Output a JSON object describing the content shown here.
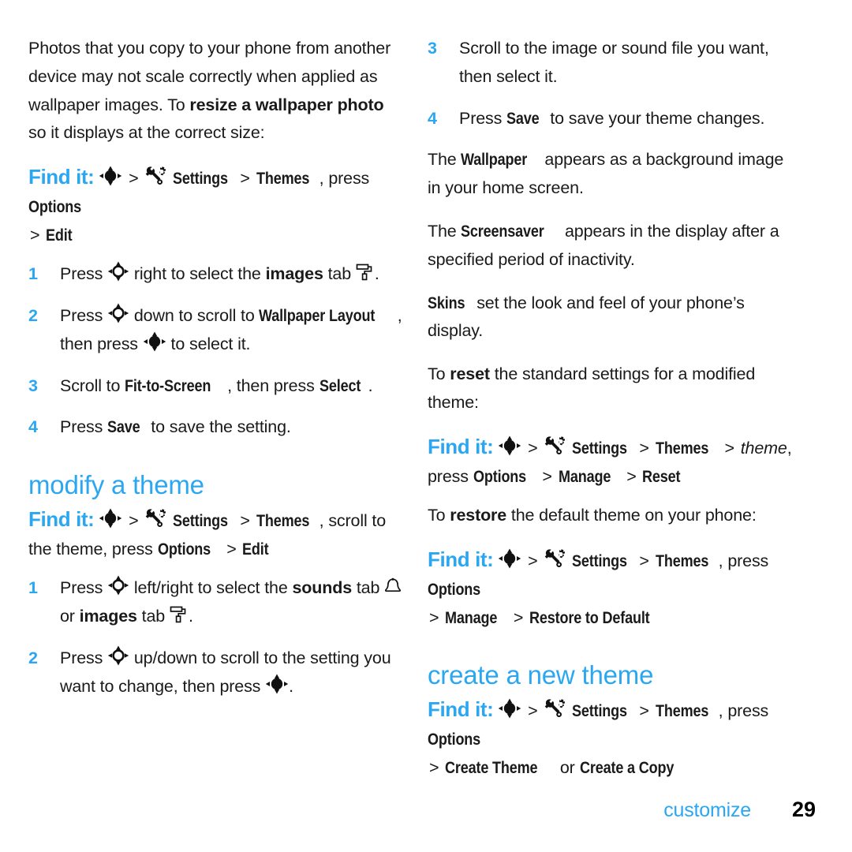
{
  "document": {
    "type": "phone-user-guide-page",
    "accent_color": "#2BA7F2",
    "text_color": "#1a1a1a",
    "background": "#ffffff"
  },
  "icons": {
    "nav_select": "navigation-key-select-icon",
    "nav_direction": "navigation-key-direction-icon",
    "settings": "settings-wrench-gear-icon",
    "images_tab": "paint-roller-icon",
    "sounds_tab": "bell-icon"
  },
  "left_column": {
    "intro_paragraph": {
      "part1": "Photos that you copy to your phone from another device may not scale correctly when applied as wallpaper images. To ",
      "bold1": "resize a wallpaper photo",
      "part2": " so it displays at the correct size:"
    },
    "find_it_resize": {
      "label": "Find it:",
      "sep": ">",
      "settings": "Settings",
      "themes": "Themes",
      "press_text": ", press ",
      "options": "Options",
      "sep2": ">",
      "edit": "Edit"
    },
    "steps_resize": [
      {
        "num": "1",
        "pre": "Press ",
        "mid": " right to select the ",
        "bold": "images",
        "post": " tab ",
        "end": "."
      },
      {
        "num": "2",
        "pre": "Press ",
        "mid": " down to scroll to ",
        "bold": "Wallpaper Layout",
        "post": ", then press ",
        "end": " to select it."
      },
      {
        "num": "3",
        "pre": "Scroll to ",
        "bold": "Fit-to-Screen",
        "mid": ", then press ",
        "bold2": "Select",
        "post": "."
      },
      {
        "num": "4",
        "pre": "Press ",
        "bold": "Save",
        "post": " to save the setting."
      }
    ],
    "heading_modify": "modify a theme",
    "find_it_modify": {
      "label": "Find it:",
      "sep": ">",
      "settings": "Settings",
      "themes": "Themes",
      "scroll_text": ", scroll to the theme, press ",
      "options": "Options",
      "sep2": ">",
      "edit": "Edit"
    },
    "steps_modify": [
      {
        "num": "1",
        "pre": "Press ",
        "mid": " left/right to select the ",
        "bold": "sounds",
        "post": " tab ",
        "mid2": " or ",
        "bold2": "images",
        "post2": " tab ",
        "end": "."
      },
      {
        "num": "2",
        "pre": "Press ",
        "mid": " up/down to scroll to the setting you want to change, then press ",
        "end": "."
      }
    ]
  },
  "right_column": {
    "steps_continued": [
      {
        "num": "3",
        "text": "Scroll to the image or sound file you want, then select it."
      },
      {
        "num": "4",
        "pre": "Press ",
        "bold": "Save",
        "post": " to save your theme changes."
      }
    ],
    "wallpaper_para": {
      "pre": "The ",
      "bold": "Wallpaper",
      "post": " appears as a background image in your home screen."
    },
    "screensaver_para": {
      "pre": "The ",
      "bold": "Screensaver",
      "post": " appears in the display after a specified period of inactivity."
    },
    "skins_para": {
      "bold": "Skins",
      "post": " set the look and feel of your phone’s display."
    },
    "reset_para": {
      "pre": "To ",
      "bold": "reset",
      "post": " the standard settings for a modified theme:"
    },
    "find_it_reset": {
      "label": "Find it:",
      "sep": ">",
      "settings": "Settings",
      "themes": "Themes",
      "sep_theme": ">",
      "theme_italic": "theme",
      "press_text": "press ",
      "options": "Options",
      "sep2": ">",
      "manage": "Manage",
      "sep3": ">",
      "reset": "Reset"
    },
    "restore_para": {
      "pre": "To ",
      "bold": "restore",
      "post": " the default theme on your phone:"
    },
    "find_it_restore": {
      "label": "Find it:",
      "sep": ">",
      "settings": "Settings",
      "themes": "Themes",
      "press_text": ", press ",
      "options": "Options",
      "sep2": ">",
      "manage": "Manage",
      "sep3": ">",
      "restore": "Restore to Default"
    },
    "heading_create": "create a new theme",
    "find_it_create": {
      "label": "Find it:",
      "sep": ">",
      "settings": "Settings",
      "themes": "Themes",
      "press_text": ", press ",
      "options": "Options",
      "sep2": ">",
      "create_theme": "Create Theme",
      "or_text": " or ",
      "create_copy": "Create a Copy"
    }
  },
  "footer": {
    "label": "customize",
    "page_number": "29"
  }
}
